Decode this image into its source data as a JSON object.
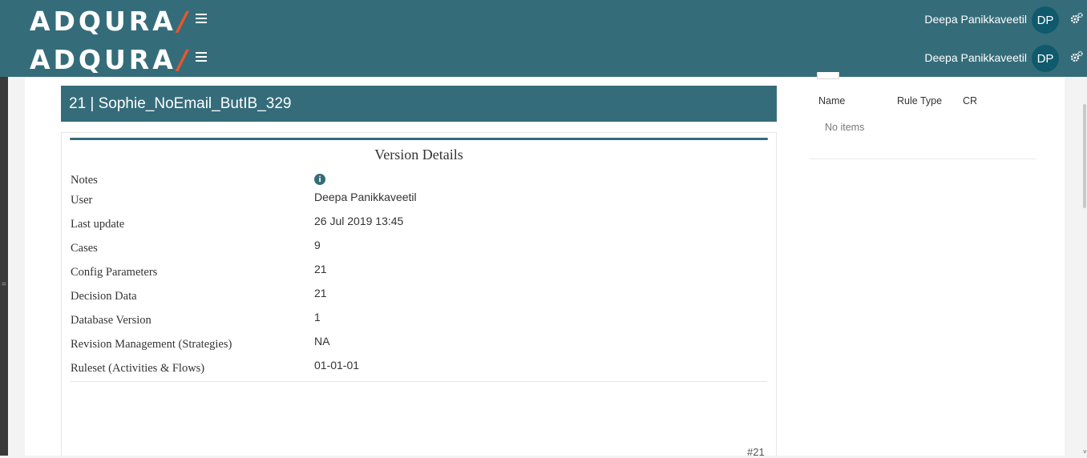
{
  "app": {
    "logo_text": "ADQURA",
    "logo_slash": "/",
    "user_name": "Deepa Panikkaveetil",
    "user_initials": "DP",
    "colors": {
      "header": "#356c7a",
      "avatar": "#0f5a6c",
      "accent": "#e8562b"
    },
    "icons": {
      "menu": "hamburger-icon",
      "settings": "gears-icon",
      "info": "info-circle-icon"
    }
  },
  "page": {
    "title": "21 | Sophie_NoEmail_ButIB_329"
  },
  "version_details": {
    "heading": "Version Details",
    "rows": [
      {
        "label": "Notes",
        "value": ""
      },
      {
        "label": "User",
        "value": "Deepa Panikkaveetil"
      },
      {
        "label": "Last update",
        "value": "26 Jul 2019 13:45"
      },
      {
        "label": "Cases",
        "value": "9"
      },
      {
        "label": "Config Parameters",
        "value": "21"
      },
      {
        "label": "Decision Data",
        "value": "21"
      },
      {
        "label": "Database Version",
        "value": "1"
      },
      {
        "label": "Revision Management (Strategies)",
        "value": "NA"
      },
      {
        "label": "Ruleset (Activities & Flows)",
        "value": "01-01-01"
      }
    ],
    "version_tag": "#21"
  },
  "rules_table": {
    "columns": [
      "Name",
      "Rule Type",
      "CR"
    ],
    "empty_text": "No items"
  }
}
